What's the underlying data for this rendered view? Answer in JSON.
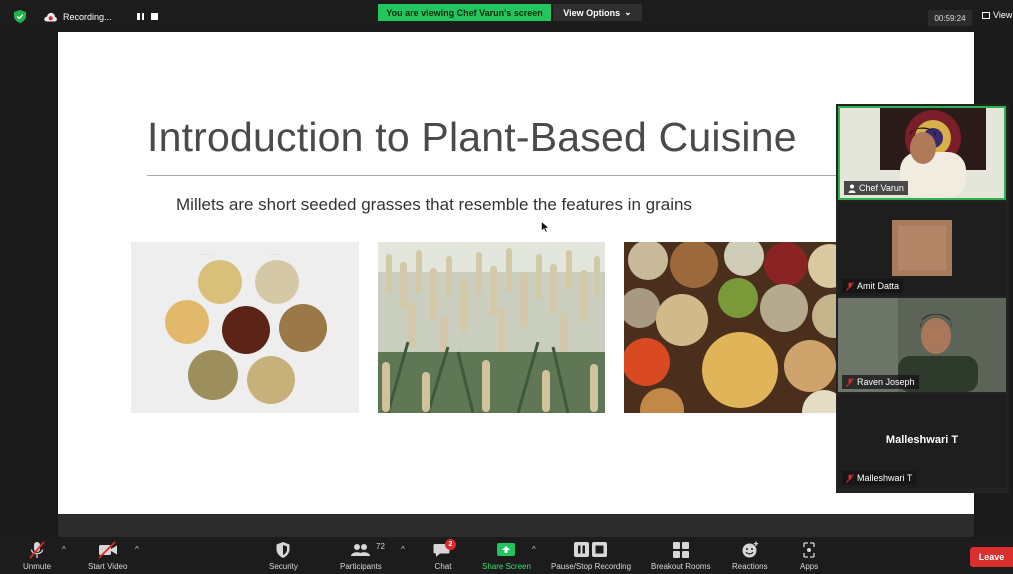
{
  "topbar": {
    "recording_label": "Recording...",
    "viewing_banner": "You are viewing Chef Varun's screen",
    "view_options_label": "View Options",
    "view_options_caret": "⌄",
    "timer": "00:59:24",
    "view_label": "View"
  },
  "slide": {
    "title": "Introduction to Plant-Based Cuisine",
    "subtitle": "Millets are short seeded grasses that resemble the features in grains"
  },
  "participants": [
    {
      "name": "Chef Varun",
      "role": "host",
      "active_speaker": true
    },
    {
      "name": "Amit Datta",
      "muted": true
    },
    {
      "name": "Raven Joseph",
      "muted": true
    },
    {
      "name": "Malleshwari T",
      "muted": true,
      "display_name_center": "Malleshwari T"
    }
  ],
  "toolbar": {
    "unmute": "Unmute",
    "start_video": "Start Video",
    "security": "Security",
    "participants": "Participants",
    "participants_count": "72",
    "chat": "Chat",
    "chat_badge": "2",
    "share_screen": "Share Screen",
    "pause_stop_recording": "Pause/Stop Recording",
    "breakout_rooms": "Breakout Rooms",
    "reactions": "Reactions",
    "apps": "Apps",
    "leave": "Leave",
    "caret": "^"
  },
  "colors": {
    "share_green": "#23c55e",
    "leave_red": "#d92f2f",
    "active_border": "#2eb24c",
    "toolbar_bg": "#1c1c1c"
  }
}
